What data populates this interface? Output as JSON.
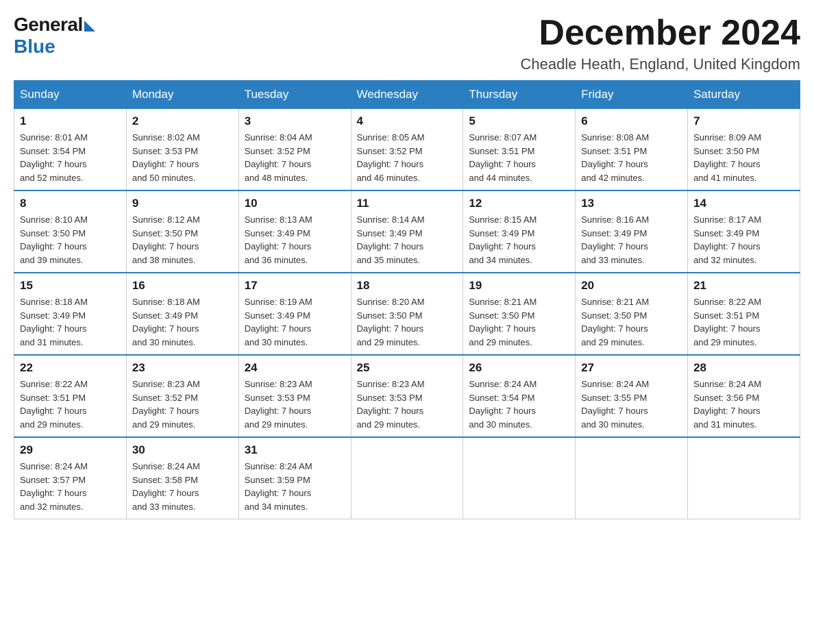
{
  "header": {
    "logo": {
      "general": "General",
      "blue": "Blue"
    },
    "title": "December 2024",
    "location": "Cheadle Heath, England, United Kingdom"
  },
  "days_of_week": [
    "Sunday",
    "Monday",
    "Tuesday",
    "Wednesday",
    "Thursday",
    "Friday",
    "Saturday"
  ],
  "weeks": [
    [
      {
        "day": "1",
        "sunrise": "8:01 AM",
        "sunset": "3:54 PM",
        "daylight": "7 hours and 52 minutes."
      },
      {
        "day": "2",
        "sunrise": "8:02 AM",
        "sunset": "3:53 PM",
        "daylight": "7 hours and 50 minutes."
      },
      {
        "day": "3",
        "sunrise": "8:04 AM",
        "sunset": "3:52 PM",
        "daylight": "7 hours and 48 minutes."
      },
      {
        "day": "4",
        "sunrise": "8:05 AM",
        "sunset": "3:52 PM",
        "daylight": "7 hours and 46 minutes."
      },
      {
        "day": "5",
        "sunrise": "8:07 AM",
        "sunset": "3:51 PM",
        "daylight": "7 hours and 44 minutes."
      },
      {
        "day": "6",
        "sunrise": "8:08 AM",
        "sunset": "3:51 PM",
        "daylight": "7 hours and 42 minutes."
      },
      {
        "day": "7",
        "sunrise": "8:09 AM",
        "sunset": "3:50 PM",
        "daylight": "7 hours and 41 minutes."
      }
    ],
    [
      {
        "day": "8",
        "sunrise": "8:10 AM",
        "sunset": "3:50 PM",
        "daylight": "7 hours and 39 minutes."
      },
      {
        "day": "9",
        "sunrise": "8:12 AM",
        "sunset": "3:50 PM",
        "daylight": "7 hours and 38 minutes."
      },
      {
        "day": "10",
        "sunrise": "8:13 AM",
        "sunset": "3:49 PM",
        "daylight": "7 hours and 36 minutes."
      },
      {
        "day": "11",
        "sunrise": "8:14 AM",
        "sunset": "3:49 PM",
        "daylight": "7 hours and 35 minutes."
      },
      {
        "day": "12",
        "sunrise": "8:15 AM",
        "sunset": "3:49 PM",
        "daylight": "7 hours and 34 minutes."
      },
      {
        "day": "13",
        "sunrise": "8:16 AM",
        "sunset": "3:49 PM",
        "daylight": "7 hours and 33 minutes."
      },
      {
        "day": "14",
        "sunrise": "8:17 AM",
        "sunset": "3:49 PM",
        "daylight": "7 hours and 32 minutes."
      }
    ],
    [
      {
        "day": "15",
        "sunrise": "8:18 AM",
        "sunset": "3:49 PM",
        "daylight": "7 hours and 31 minutes."
      },
      {
        "day": "16",
        "sunrise": "8:18 AM",
        "sunset": "3:49 PM",
        "daylight": "7 hours and 30 minutes."
      },
      {
        "day": "17",
        "sunrise": "8:19 AM",
        "sunset": "3:49 PM",
        "daylight": "7 hours and 30 minutes."
      },
      {
        "day": "18",
        "sunrise": "8:20 AM",
        "sunset": "3:50 PM",
        "daylight": "7 hours and 29 minutes."
      },
      {
        "day": "19",
        "sunrise": "8:21 AM",
        "sunset": "3:50 PM",
        "daylight": "7 hours and 29 minutes."
      },
      {
        "day": "20",
        "sunrise": "8:21 AM",
        "sunset": "3:50 PM",
        "daylight": "7 hours and 29 minutes."
      },
      {
        "day": "21",
        "sunrise": "8:22 AM",
        "sunset": "3:51 PM",
        "daylight": "7 hours and 29 minutes."
      }
    ],
    [
      {
        "day": "22",
        "sunrise": "8:22 AM",
        "sunset": "3:51 PM",
        "daylight": "7 hours and 29 minutes."
      },
      {
        "day": "23",
        "sunrise": "8:23 AM",
        "sunset": "3:52 PM",
        "daylight": "7 hours and 29 minutes."
      },
      {
        "day": "24",
        "sunrise": "8:23 AM",
        "sunset": "3:53 PM",
        "daylight": "7 hours and 29 minutes."
      },
      {
        "day": "25",
        "sunrise": "8:23 AM",
        "sunset": "3:53 PM",
        "daylight": "7 hours and 29 minutes."
      },
      {
        "day": "26",
        "sunrise": "8:24 AM",
        "sunset": "3:54 PM",
        "daylight": "7 hours and 30 minutes."
      },
      {
        "day": "27",
        "sunrise": "8:24 AM",
        "sunset": "3:55 PM",
        "daylight": "7 hours and 30 minutes."
      },
      {
        "day": "28",
        "sunrise": "8:24 AM",
        "sunset": "3:56 PM",
        "daylight": "7 hours and 31 minutes."
      }
    ],
    [
      {
        "day": "29",
        "sunrise": "8:24 AM",
        "sunset": "3:57 PM",
        "daylight": "7 hours and 32 minutes."
      },
      {
        "day": "30",
        "sunrise": "8:24 AM",
        "sunset": "3:58 PM",
        "daylight": "7 hours and 33 minutes."
      },
      {
        "day": "31",
        "sunrise": "8:24 AM",
        "sunset": "3:59 PM",
        "daylight": "7 hours and 34 minutes."
      },
      null,
      null,
      null,
      null
    ]
  ],
  "labels": {
    "sunrise": "Sunrise:",
    "sunset": "Sunset:",
    "daylight": "Daylight:"
  }
}
